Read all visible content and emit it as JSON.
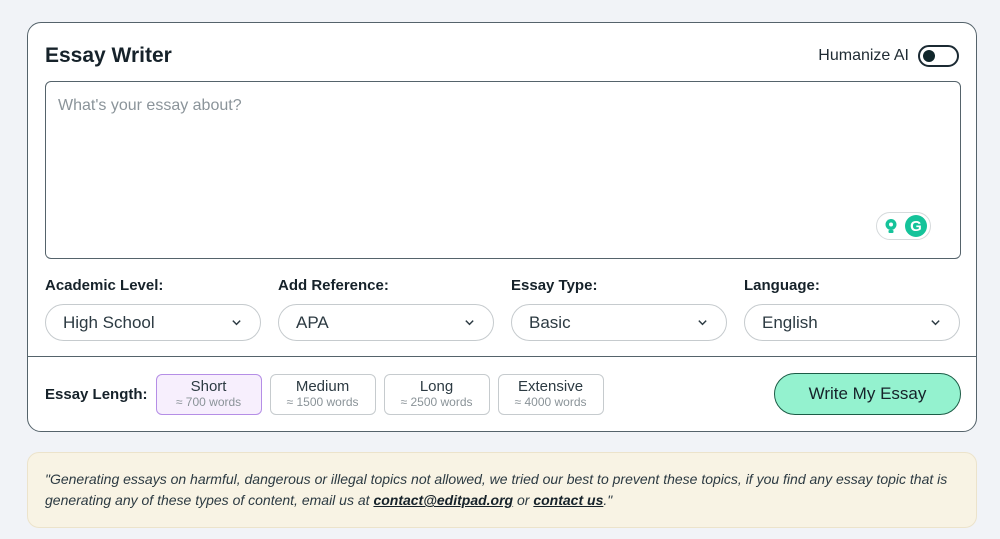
{
  "header": {
    "title": "Essay Writer",
    "humanize_label": "Humanize AI",
    "humanize_on": false
  },
  "input": {
    "placeholder": "What's your essay about?",
    "value": ""
  },
  "selects": [
    {
      "label": "Academic Level:",
      "value": "High School"
    },
    {
      "label": "Add Reference:",
      "value": "APA"
    },
    {
      "label": "Essay Type:",
      "value": "Basic"
    },
    {
      "label": "Language:",
      "value": "English"
    }
  ],
  "length": {
    "label": "Essay Length:",
    "options": [
      {
        "title": "Short",
        "sub": "≈ 700 words",
        "selected": true
      },
      {
        "title": "Medium",
        "sub": "≈ 1500 words",
        "selected": false
      },
      {
        "title": "Long",
        "sub": "≈ 2500 words",
        "selected": false
      },
      {
        "title": "Extensive",
        "sub": "≈ 4000 words",
        "selected": false
      }
    ]
  },
  "submit_label": "Write My Essay",
  "notice": {
    "text_before": "\"Generating essays on harmful, dangerous or illegal topics not allowed, we tried our best to prevent these topics, if you find any essay topic that is generating any of these types of content, email us at ",
    "email": "contact@editpad.org",
    "text_middle": " or ",
    "contact_link": "contact us",
    "text_after": ".\""
  },
  "colors": {
    "accent": "#94f2cf",
    "selected_bg": "#f7effd",
    "selected_border": "#b58ee6",
    "notice_bg": "#f8f3e4",
    "grammarly": "#15c39a"
  },
  "icons": [
    "lightbulb-icon",
    "grammarly-icon",
    "chevron-down-icon"
  ]
}
